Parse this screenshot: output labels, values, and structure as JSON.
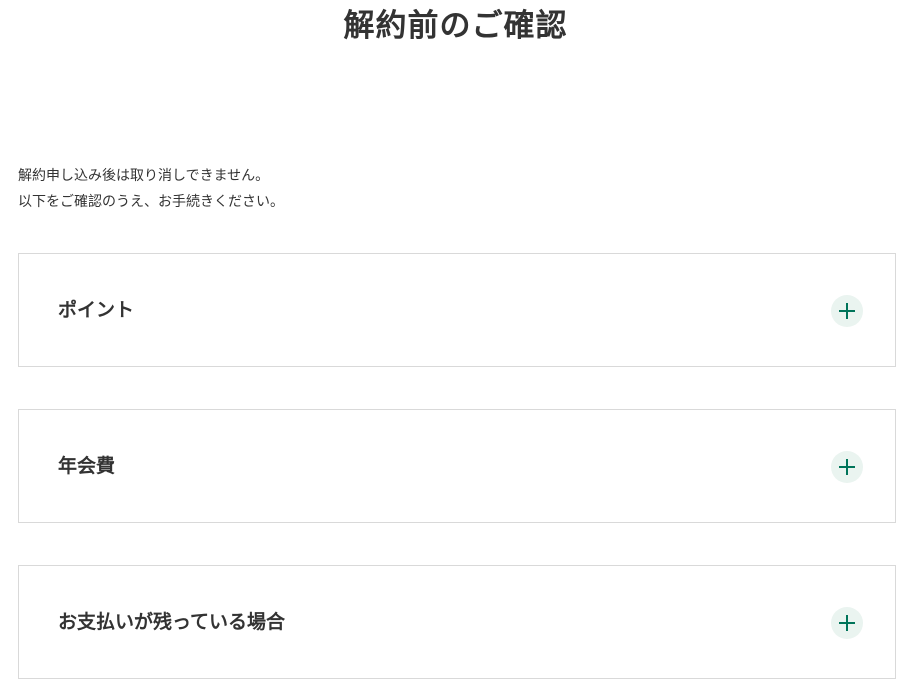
{
  "page": {
    "title": "解約前のご確認"
  },
  "notice": {
    "line1": "解約申し込み後は取り消しできません。",
    "line2": "以下をご確認のうえ、お手続きください。"
  },
  "accordions": [
    {
      "label": "ポイント",
      "icon": "plus-icon"
    },
    {
      "label": "年会費",
      "icon": "plus-icon"
    },
    {
      "label": "お支払いが残っている場合",
      "icon": "plus-icon"
    }
  ],
  "colors": {
    "accent": "#00745a",
    "icon_background": "#eaf4f0",
    "border": "#d9d9d9",
    "text": "#333333"
  }
}
